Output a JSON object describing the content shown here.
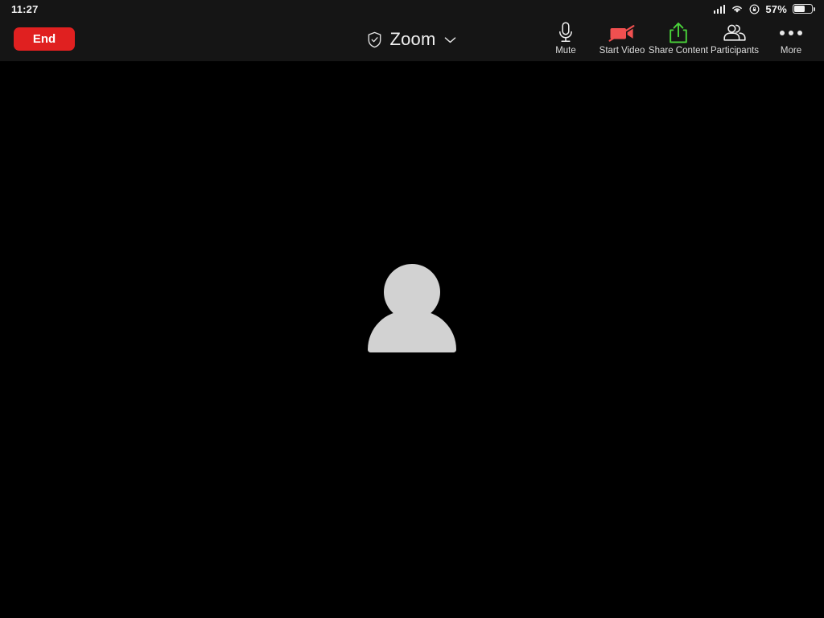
{
  "status_bar": {
    "time": "11:27",
    "battery_percent_label": "57%",
    "battery_level": 57,
    "icons": [
      "cellular-signal-icon",
      "wifi-icon",
      "rotation-lock-icon",
      "battery-icon"
    ]
  },
  "toolbar": {
    "end_label": "End",
    "meeting_title": "Zoom",
    "encryption_icon": "shield-check-icon",
    "title_chevron_icon": "chevron-down-icon",
    "actions": [
      {
        "label": "Mute",
        "icon": "microphone-icon",
        "color": "#ffffff"
      },
      {
        "label": "Start Video",
        "icon": "video-off-icon",
        "color": "#f05050"
      },
      {
        "label": "Share Content",
        "icon": "share-upload-icon",
        "color": "#4ad43a"
      },
      {
        "label": "Participants",
        "icon": "participants-icon",
        "color": "#ffffff"
      },
      {
        "label": "More",
        "icon": "ellipsis-icon",
        "color": "#e8e8e8"
      }
    ]
  },
  "video_stage": {
    "avatar_icon": "person-placeholder-icon",
    "avatar_color": "#d2d2d2",
    "background_color": "#000000"
  },
  "colors": {
    "end_button": "#e02020",
    "bar_background": "#151515",
    "stage_background": "#000000",
    "video_off": "#f05050",
    "share_green": "#4ad43a"
  }
}
